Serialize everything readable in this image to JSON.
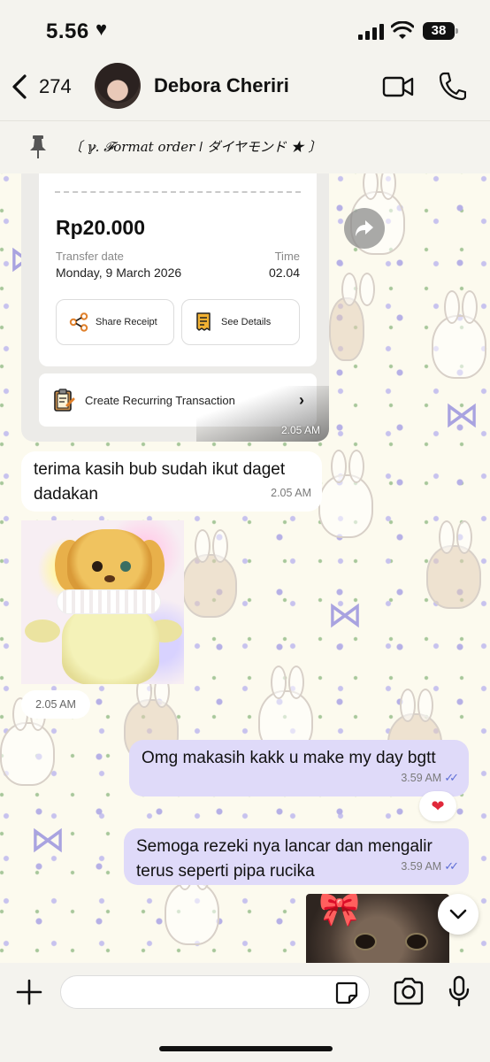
{
  "status_bar": {
    "time": "5.56",
    "heart": "♥",
    "battery": "38",
    "battery_level_percent": 38
  },
  "header": {
    "back_count": "274",
    "contact_name": "Debora Cheriri",
    "icons": [
      "chevron-left-icon",
      "video-camera-icon",
      "phone-icon"
    ]
  },
  "pinned": {
    "text": "〔 ℽ. 𝓕ormat order ǀ  ダイヤモンド ★ 〕",
    "icon": "pin-icon"
  },
  "receipt": {
    "amount": "Rp20.000",
    "transfer_date_label": "Transfer date",
    "transfer_date": "Monday, 9 March 2026",
    "time_label": "Time",
    "time_value": "02.04",
    "share_label": "Share Receipt",
    "details_label": "See Details",
    "recurring_label": "Create Recurring Transaction",
    "message_time": "2.05 AM"
  },
  "messages": [
    {
      "direction": "incoming",
      "text": "terima kasih bub sudah ikut daget dadakan",
      "time": "2.05 AM"
    },
    {
      "direction": "incoming",
      "type": "sticker",
      "time": "2.05 AM"
    },
    {
      "direction": "outgoing",
      "text": "Omg makasih kakk u make my day bgtt",
      "time": "3.59 AM",
      "ticks": "✓✓",
      "reaction": "❤"
    },
    {
      "direction": "outgoing",
      "text": "Semoga rezeki nya lancar dan mengalir terus seperti pipa rucika",
      "time": "3.59 AM",
      "ticks": "✓✓"
    }
  ],
  "input": {
    "placeholder": "",
    "value": ""
  },
  "colors": {
    "outgoing_bubble": "#dfdaf9",
    "incoming_bubble": "#ffffff",
    "read_ticks": "#5e6fd6",
    "reaction_heart": "#e0283a",
    "wallpaper_flowers": "#b6b0e6"
  }
}
